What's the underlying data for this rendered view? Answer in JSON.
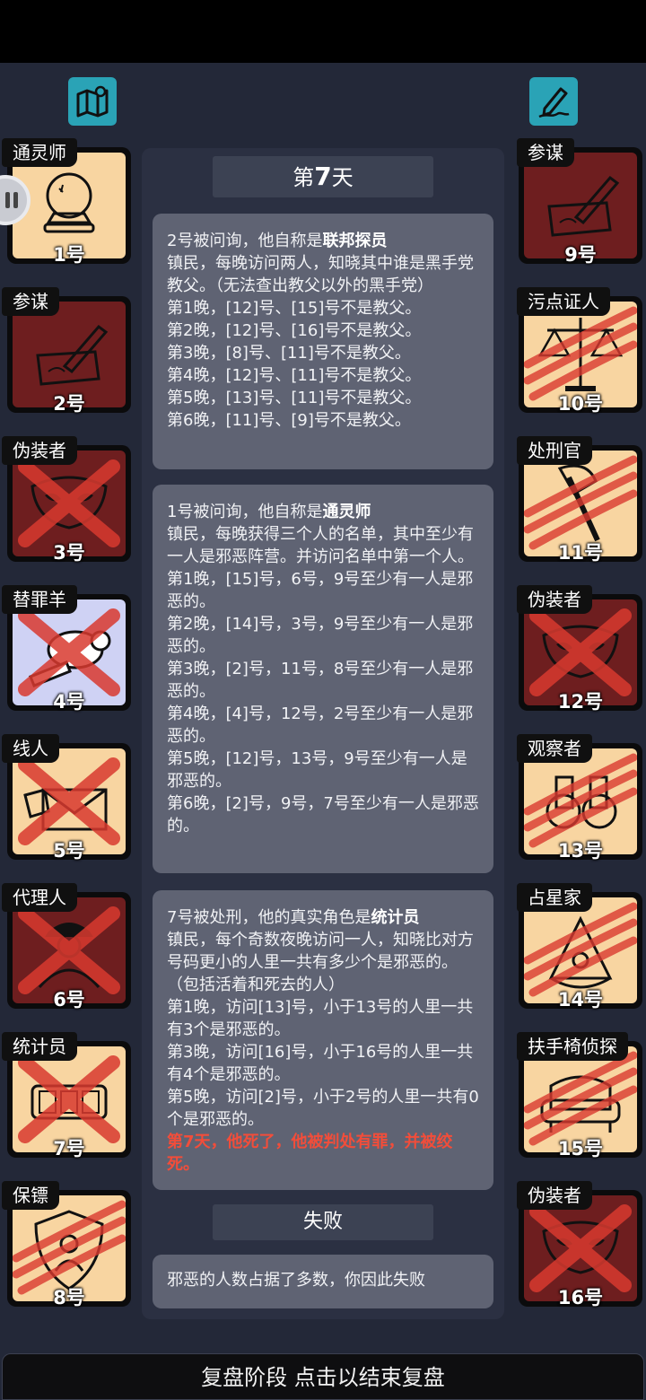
{
  "header": {
    "map_icon": "map-icon",
    "notes_icon": "pencil-note-icon"
  },
  "left_players": [
    {
      "role": "通灵师",
      "number": "1号",
      "icon": "crystal-ball-icon",
      "team": "good",
      "mark": "none"
    },
    {
      "role": "参谋",
      "number": "2号",
      "icon": "quill-letter-icon",
      "team": "evil",
      "mark": "none"
    },
    {
      "role": "伪装者",
      "number": "3号",
      "icon": "mask-icon",
      "team": "evil",
      "mark": "x"
    },
    {
      "role": "替罪羊",
      "number": "4号",
      "icon": "goat-icon",
      "team": "goat",
      "mark": "x"
    },
    {
      "role": "线人",
      "number": "5号",
      "icon": "envelope-icon",
      "team": "good",
      "mark": "x"
    },
    {
      "role": "代理人",
      "number": "6号",
      "icon": "agent-icon",
      "team": "evil",
      "mark": "x"
    },
    {
      "role": "统计员",
      "number": "7号",
      "icon": "counter-icon",
      "team": "good",
      "mark": "x"
    },
    {
      "role": "保镖",
      "number": "8号",
      "icon": "shield-icon",
      "team": "good",
      "mark": "claw"
    }
  ],
  "right_players": [
    {
      "role": "参谋",
      "number": "9号",
      "icon": "quill-letter-icon",
      "team": "evil",
      "mark": "none"
    },
    {
      "role": "污点证人",
      "number": "10号",
      "icon": "scales-icon",
      "team": "good",
      "mark": "claw"
    },
    {
      "role": "处刑官",
      "number": "11号",
      "icon": "axe-icon",
      "team": "good",
      "mark": "claw"
    },
    {
      "role": "伪装者",
      "number": "12号",
      "icon": "mask-icon",
      "team": "evil",
      "mark": "x"
    },
    {
      "role": "观察者",
      "number": "13号",
      "icon": "binoculars-icon",
      "team": "good",
      "mark": "claw"
    },
    {
      "role": "占星家",
      "number": "14号",
      "icon": "sextant-icon",
      "team": "good",
      "mark": "claw"
    },
    {
      "role": "扶手椅侦探",
      "number": "15号",
      "icon": "armchair-icon",
      "team": "good",
      "mark": "claw"
    },
    {
      "role": "伪装者",
      "number": "16号",
      "icon": "mask-icon",
      "team": "evil",
      "mark": "x"
    }
  ],
  "day": {
    "prefix": "第",
    "num": "7",
    "suffix": "天"
  },
  "messages": [
    {
      "intro": "2号被问询，他自称是",
      "role": "联邦探员",
      "body": "镇民，每晚访问两人，知晓其中谁是黑手党教父。（无法查出教父以外的黑手党）\n第1晚，[12]号、[15]号不是教父。\n第2晚，[12]号、[16]号不是教父。\n第3晚，[8]号、[11]号不是教父。\n第4晚，[12]号、[11]号不是教父。\n第5晚，[13]号、[11]号不是教父。\n第6晚，[11]号、[9]号不是教父。",
      "red": ""
    },
    {
      "intro": "1号被问询，他自称是",
      "role": "通灵师",
      "body": "镇民，每晚获得三个人的名单，其中至少有一人是邪恶阵营。并访问名单中第一个人。\n第1晚，[15]号，6号，9号至少有一人是邪恶的。\n第2晚，[14]号，3号，9号至少有一人是邪恶的。\n第3晚，[2]号，11号，8号至少有一人是邪恶的。\n第4晚，[4]号，12号，2号至少有一人是邪恶的。\n第5晚，[12]号，13号，9号至少有一人是邪恶的。\n第6晚，[2]号，9号，7号至少有一人是邪恶的。",
      "red": ""
    },
    {
      "intro": "7号被处刑，他的真实角色是",
      "role": "统计员",
      "body": "镇民，每个奇数夜晚访问一人，知晓比对方号码更小的人里一共有多少个是邪恶的。（包括活着和死去的人）\n第1晚，访问[13]号，小于13号的人里一共有3个是邪恶的。\n第3晚，访问[16]号，小于16号的人里一共有4个是邪恶的。\n第5晚，访问[2]号，小于2号的人里一共有0个是邪恶的。",
      "red": "第7天，他死了，他被判处有罪，并被绞死。"
    }
  ],
  "result": {
    "title": "失败",
    "message": "邪恶的人数占据了多数，你因此失败"
  },
  "footer": {
    "label": "复盘阶段 点击以结束复盘"
  },
  "colors": {
    "background": "#232838",
    "panel": "#2b3042",
    "message": "#5f6373",
    "good_card": "#f8d5a1",
    "evil_card": "#6e1e1f",
    "mark_red": "#d93a30",
    "highlight_red": "#f24d3a",
    "icon_teal": "#2aa3b6"
  }
}
